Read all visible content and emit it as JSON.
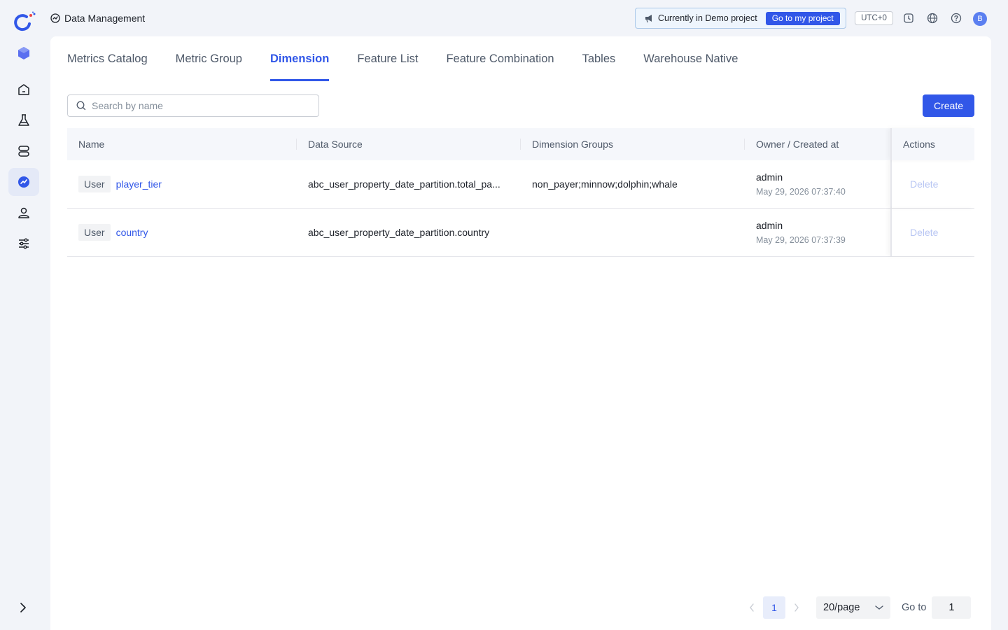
{
  "header": {
    "title": "Data Management",
    "demo_text": "Currently in Demo project",
    "demo_button": "Go to my project",
    "timezone": "UTC+0",
    "avatar_initial": "B"
  },
  "sidebar": {
    "items": [
      {
        "icon": "cube-icon"
      },
      {
        "icon": "home-icon"
      },
      {
        "icon": "flask-icon"
      },
      {
        "icon": "database-icon"
      },
      {
        "icon": "data-management-icon",
        "active": true
      },
      {
        "icon": "user-icon"
      },
      {
        "icon": "sliders-icon"
      }
    ],
    "expand_icon": "chevron-right-icon"
  },
  "tabs": [
    {
      "label": "Metrics Catalog"
    },
    {
      "label": "Metric Group"
    },
    {
      "label": "Dimension",
      "active": true
    },
    {
      "label": "Feature List"
    },
    {
      "label": "Feature Combination"
    },
    {
      "label": "Tables"
    },
    {
      "label": "Warehouse Native"
    }
  ],
  "search": {
    "placeholder": "Search by name",
    "value": ""
  },
  "create_label": "Create",
  "table": {
    "columns": [
      "Name",
      "Data Source",
      "Dimension Groups",
      "Owner / Created at",
      "Actions"
    ],
    "rows": [
      {
        "tag": "User",
        "name": "player_tier",
        "data_source": "abc_user_property_date_partition.total_pa...",
        "groups": "non_payer;minnow;dolphin;whale",
        "owner": "admin",
        "created_at": "May 29, 2026 07:37:40",
        "action": "Delete"
      },
      {
        "tag": "User",
        "name": "country",
        "data_source": "abc_user_property_date_partition.country",
        "groups": "",
        "owner": "admin",
        "created_at": "May 29, 2026 07:37:39",
        "action": "Delete"
      }
    ]
  },
  "pagination": {
    "current_page": "1",
    "page_size": "20/page",
    "goto_label": "Go to",
    "goto_value": "1"
  },
  "colors": {
    "accent": "#3157e8",
    "background": "#f2f4f9"
  }
}
